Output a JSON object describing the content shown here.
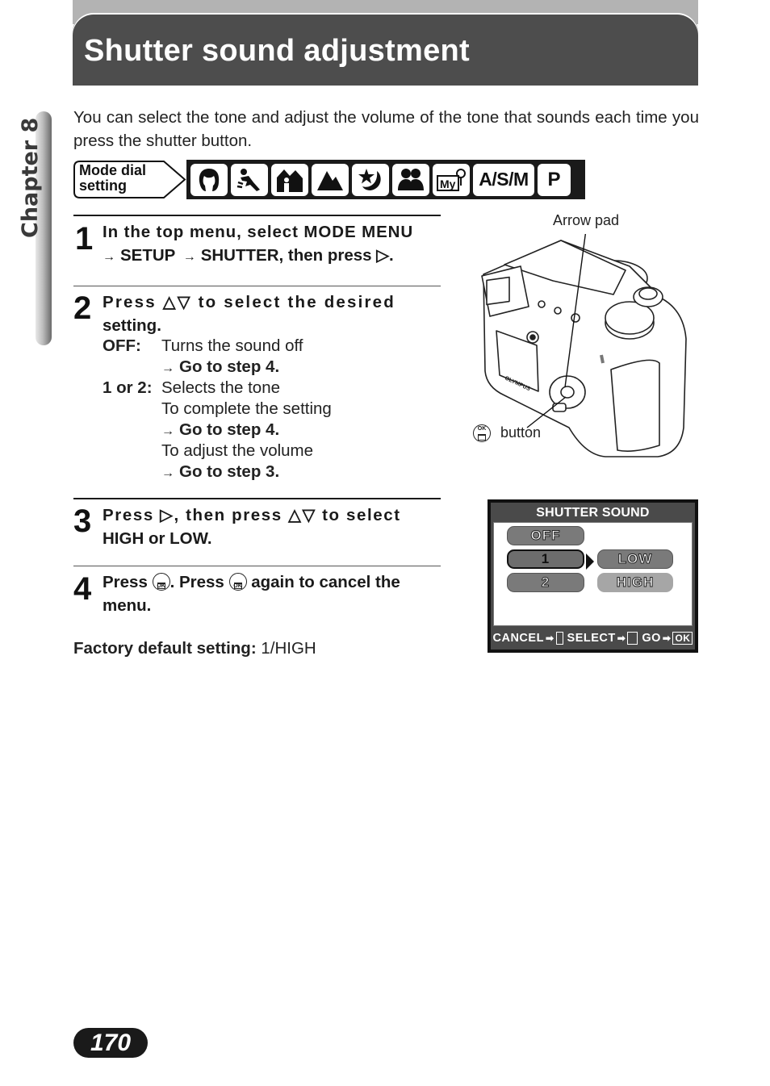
{
  "header": {
    "title": "Shutter sound adjustment"
  },
  "chapter_tab": {
    "label": "Chapter 8"
  },
  "intro": "You can select the tone and adjust the volume of the tone that sounds each time you press the shutter button.",
  "mode_dial": {
    "label_line1": "Mode dial",
    "label_line2": "setting",
    "icons": [
      {
        "name": "portrait-icon",
        "glyph": "☺"
      },
      {
        "name": "sports-icon",
        "glyph": "🏃"
      },
      {
        "name": "landscape-portrait-icon",
        "glyph": "⌂"
      },
      {
        "name": "landscape-icon",
        "glyph": "▲"
      },
      {
        "name": "night-scene-icon",
        "glyph": "★"
      },
      {
        "name": "self-portrait-icon",
        "glyph": "👥"
      },
      {
        "name": "my-mode-icon",
        "glyph": "My"
      }
    ],
    "asm_label": "A/S/M",
    "p_label": "P"
  },
  "steps": [
    {
      "number": "1",
      "line1": "In the top menu, select MODE MENU",
      "line2_a": "SETUP",
      "line2_b": "SHUTTER",
      "line2_c": ", then press ▷."
    },
    {
      "number": "2",
      "line1": "Press △▽ to select the desired",
      "line2": "setting.",
      "options": {
        "off_key": "OFF:",
        "off_desc": "Turns the sound off",
        "off_goto": "Go to step 4.",
        "tone_key": "1 or 2:",
        "tone_desc": "Selects the tone",
        "complete_desc": "To complete the setting",
        "complete_goto": "Go to step 4.",
        "adjust_desc": "To adjust the volume",
        "adjust_goto": "Go to step 3."
      }
    },
    {
      "number": "3",
      "line1": "Press ▷, then press △▽ to select",
      "line2": "HIGH or LOW."
    },
    {
      "number": "4",
      "line1_a": "Press",
      "line1_b": ". Press",
      "line1_c": "again to cancel the",
      "line2": "menu."
    }
  ],
  "factory_default": {
    "label": "Factory default setting:",
    "value": "1/HIGH"
  },
  "camera_figure": {
    "arrow_pad_label": "Arrow pad",
    "ok_button_label": "button"
  },
  "lcd_screen": {
    "title": "SHUTTER SOUND",
    "tone_options": [
      "OFF",
      "1",
      "2"
    ],
    "selected_tone": "1",
    "volume_options": [
      "LOW",
      "HIGH"
    ],
    "highlighted_volume": "HIGH",
    "footer": {
      "cancel": "CANCEL",
      "select": "SELECT",
      "go": "GO",
      "ok_key": "OK"
    }
  },
  "page_number": "170"
}
